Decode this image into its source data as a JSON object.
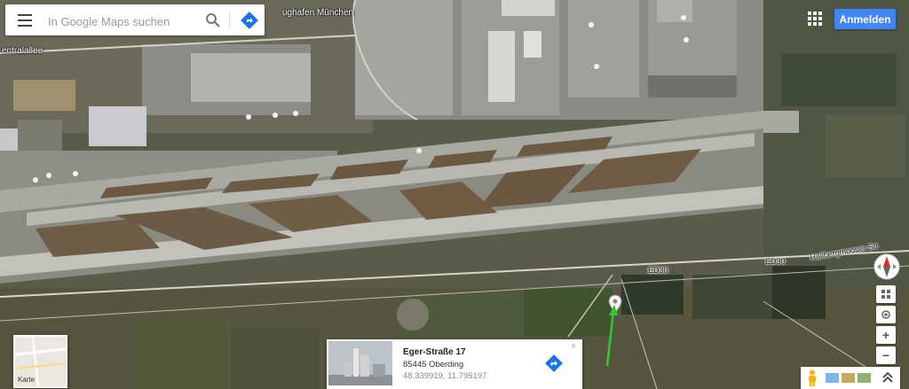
{
  "search": {
    "placeholder": "In Google Maps suchen"
  },
  "map_labels": {
    "poi_airport": "ughafen München",
    "street_centralallee": "entralallee",
    "road_ed30_left": "ED30",
    "road_ed30_right": "ED30",
    "street_hallbergmoos": "Hallbergmooser-Str"
  },
  "header": {
    "signin_label": "Anmelden"
  },
  "minimap": {
    "label": "Karte"
  },
  "place_card": {
    "title": "Eger-Straße 17",
    "locality": "85445 Oberding",
    "coords": "48.339919, 11.795197",
    "close": "×"
  },
  "controls": {
    "zoom_in": "+",
    "zoom_out": "−"
  },
  "icons": [
    "menu-icon",
    "search-icon",
    "directions-icon",
    "apps-grid-icon",
    "compass-icon",
    "tilt-icon",
    "my-location-icon",
    "pegman-icon",
    "expand-icon",
    "location-pin-icon",
    "arrow-indicator-icon"
  ],
  "colors": {
    "signin": "#4285f4",
    "directions": "#1a73e8",
    "arrow": "#2ecc2e"
  }
}
